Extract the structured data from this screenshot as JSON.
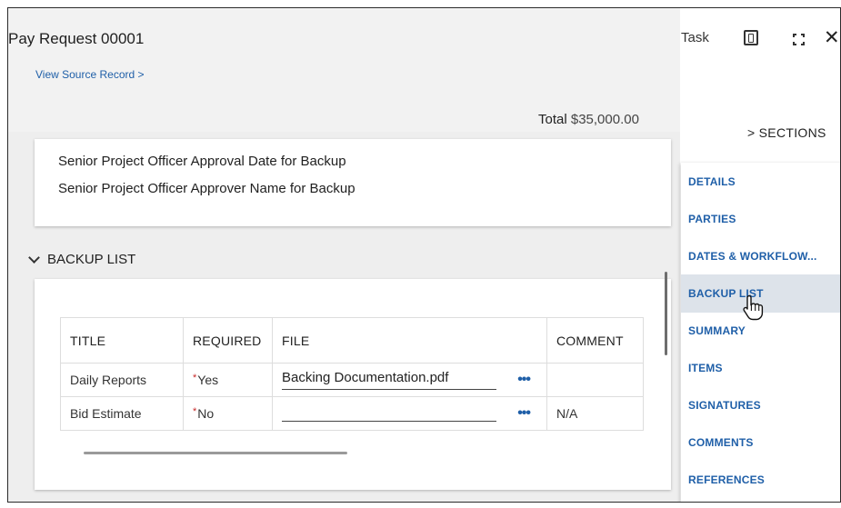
{
  "window": {
    "title": "Pay Request 00001",
    "view_source_link": "View Source Record >",
    "task_label": "Task"
  },
  "summary": {
    "total_label": "Total",
    "total_value": "$35,000.00"
  },
  "approval_card": {
    "lines": [
      "Senior Project Officer Approval Date for Backup",
      "Senior Project Officer Approver Name for Backup"
    ]
  },
  "backup_section": {
    "title": "BACKUP LIST",
    "columns": [
      "TITLE",
      "REQUIRED",
      "FILE",
      "COMMENT"
    ],
    "rows": [
      {
        "title": "Daily Reports",
        "required": "Yes",
        "file": "Backing Documentation.pdf",
        "more": "•••",
        "comment": ""
      },
      {
        "title": "Bid Estimate",
        "required": "No",
        "file": "",
        "more": "•••",
        "comment": "N/A"
      }
    ],
    "required_marker": "*"
  },
  "sections_nav": {
    "title": "> SECTIONS",
    "items": [
      {
        "label": "DETAILS"
      },
      {
        "label": "PARTIES"
      },
      {
        "label": "DATES & WORKFLOW..."
      },
      {
        "label": "BACKUP LIST",
        "active": true
      },
      {
        "label": "SUMMARY"
      },
      {
        "label": "ITEMS"
      },
      {
        "label": "SIGNATURES"
      },
      {
        "label": "COMMENTS"
      },
      {
        "label": "REFERENCES"
      }
    ]
  },
  "icons": {
    "task_panel": "task-panel-icon",
    "expand": "expand-icon",
    "close": "close-icon",
    "cursor": "hand-pointer-icon"
  },
  "colors": {
    "link": "#1f5fa8",
    "required_star": "#c62828",
    "active_nav_bg": "#dde3ea",
    "main_bg": "#eeeeee"
  }
}
